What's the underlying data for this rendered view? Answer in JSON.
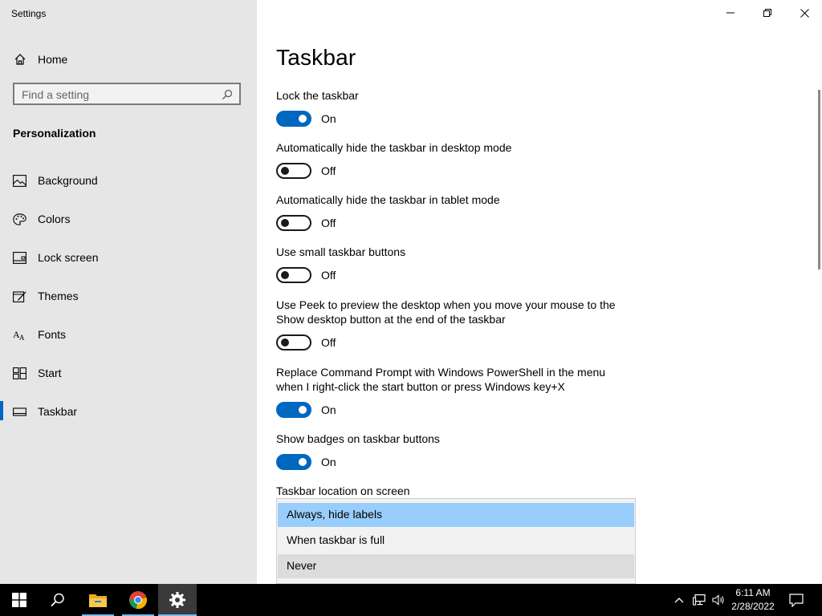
{
  "window": {
    "title": "Settings"
  },
  "sidebar": {
    "home_label": "Home",
    "search": {
      "placeholder": "Find a setting"
    },
    "section_title": "Personalization",
    "items": [
      {
        "label": "Background",
        "icon": "picture-icon"
      },
      {
        "label": "Colors",
        "icon": "palette-icon"
      },
      {
        "label": "Lock screen",
        "icon": "lock-screen-icon"
      },
      {
        "label": "Themes",
        "icon": "themes-icon"
      },
      {
        "label": "Fonts",
        "icon": "fonts-icon"
      },
      {
        "label": "Start",
        "icon": "start-icon"
      },
      {
        "label": "Taskbar",
        "icon": "taskbar-icon",
        "active": true
      }
    ]
  },
  "page": {
    "title": "Taskbar",
    "settings": [
      {
        "label": "Lock the taskbar",
        "state": "On"
      },
      {
        "label": "Automatically hide the taskbar in desktop mode",
        "state": "Off"
      },
      {
        "label": "Automatically hide the taskbar in tablet mode",
        "state": "Off"
      },
      {
        "label": "Use small taskbar buttons",
        "state": "Off"
      },
      {
        "label": "Use Peek to preview the desktop when you move your mouse to the Show desktop button at the end of the taskbar",
        "state": "Off"
      },
      {
        "label": "Replace Command Prompt with Windows PowerShell in the menu when I right-click the start button or press Windows key+X",
        "state": "On"
      },
      {
        "label": "Show badges on taskbar buttons",
        "state": "On"
      }
    ],
    "location_label": "Taskbar location on screen",
    "dropdown_options": [
      {
        "label": "Always, hide labels",
        "selected": true
      },
      {
        "label": "When taskbar is full"
      },
      {
        "label": "Never",
        "hover": true
      }
    ]
  },
  "taskbar": {
    "clock_time": "6:11 AM",
    "clock_date": "2/28/2022",
    "apps": [
      "windows-start-icon",
      "search-icon",
      "file-explorer-icon",
      "chrome-icon",
      "settings-gear-icon"
    ]
  },
  "colors": {
    "accent": "#0067c0",
    "selected_option": "#99cdfb",
    "sidebar_bg": "#e6e6e6"
  }
}
